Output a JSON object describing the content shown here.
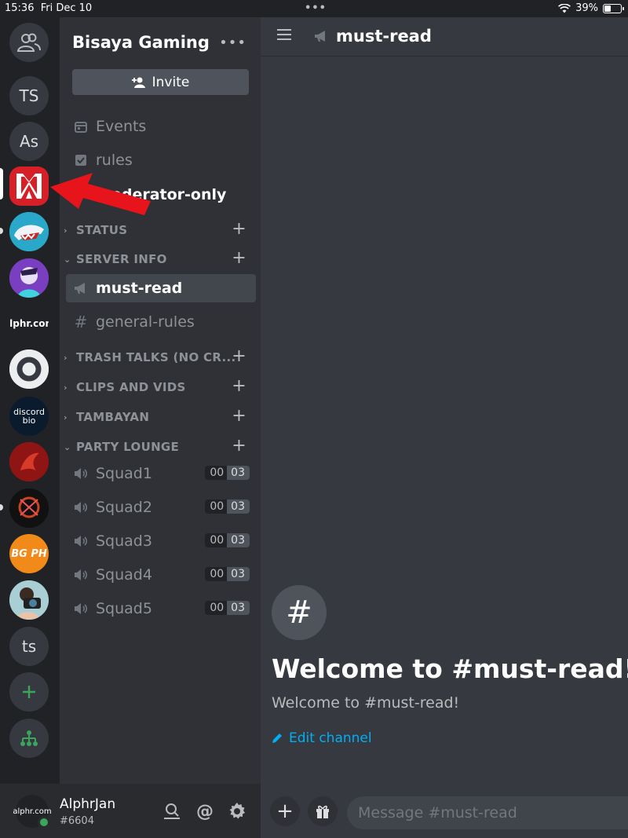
{
  "status_bar": {
    "time": "15:36",
    "date": "Fri Dec 10",
    "battery": "39%",
    "battery_level": 0.39
  },
  "guilds": {
    "items": [
      {
        "label": "TS"
      },
      {
        "label": "As"
      },
      {
        "label": "alphr.com"
      },
      {
        "label": "discord bio"
      },
      {
        "label": "BG PH"
      },
      {
        "label": "ts"
      }
    ]
  },
  "server": {
    "name": "Bisaya Gaming",
    "invite_label": "Invite",
    "channels_top": [
      "Events",
      "rules",
      "moderator-only"
    ],
    "categories": {
      "status": "STATUS",
      "server_info": "SERVER INFO",
      "trash_talks": "TRASH TALKS (NO CR...",
      "clips": "CLIPS AND VIDS",
      "tambayan": "TAMBAYAN",
      "party_lounge": "PARTY LOUNGE"
    },
    "server_info_channels": [
      "must-read",
      "general-rules"
    ],
    "voice_channels": [
      {
        "name": "Squad1",
        "count": "00",
        "limit": "03"
      },
      {
        "name": "Squad2",
        "count": "00",
        "limit": "03"
      },
      {
        "name": "Squad3",
        "count": "00",
        "limit": "03"
      },
      {
        "name": "Squad4",
        "count": "00",
        "limit": "03"
      },
      {
        "name": "Squad5",
        "count": "00",
        "limit": "03"
      }
    ]
  },
  "user": {
    "name": "AlphrJan",
    "tag": "#6604",
    "avatar_text": "alphr.com"
  },
  "channel": {
    "name": "must-read",
    "welcome_title": "Welcome to #must-read!",
    "welcome_sub": "Welcome to #must-read!",
    "edit_label": "Edit channel",
    "message_placeholder": "Message #must-read"
  },
  "colors": {
    "accent_green": "#3ba55d",
    "link_blue": "#00aff4",
    "annotation_red": "#e8141b"
  }
}
